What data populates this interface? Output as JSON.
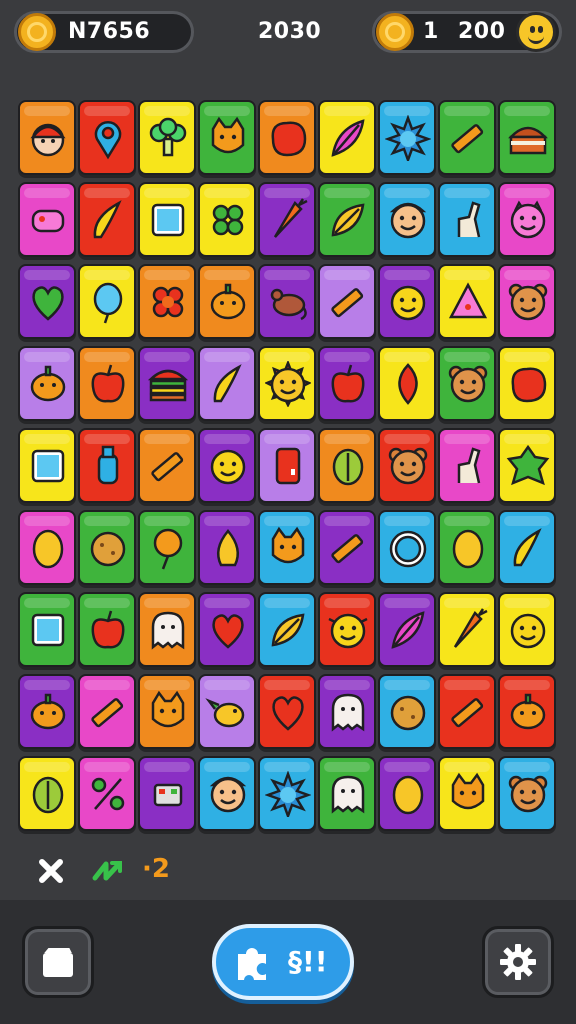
{
  "hud": {
    "player_name": "N7656",
    "score": "2030",
    "level": "1",
    "coins": "200",
    "coin_icon": "coin-icon",
    "avatar_icon": "smiley-icon"
  },
  "board": {
    "rows": 9,
    "cols": 9,
    "tiles": [
      {
        "color": "#f08a1e",
        "icon": "boy-face"
      },
      {
        "color": "#e8321e",
        "icon": "map-pin"
      },
      {
        "color": "#f7e51b",
        "icon": "broccoli"
      },
      {
        "color": "#3fb43c",
        "icon": "cat-face"
      },
      {
        "color": "#f08a1e",
        "icon": "blob"
      },
      {
        "color": "#f7e51b",
        "icon": "feather"
      },
      {
        "color": "#2fb0e4",
        "icon": "sun-gear"
      },
      {
        "color": "#3fb43c",
        "icon": "crayon"
      },
      {
        "color": "#3fb43c",
        "icon": "cake"
      },
      {
        "color": "#e848c8",
        "icon": "candy"
      },
      {
        "color": "#e8321e",
        "icon": "banana"
      },
      {
        "color": "#f7e51b",
        "icon": "tablet"
      },
      {
        "color": "#f7e51b",
        "icon": "clover"
      },
      {
        "color": "#8a2fc4",
        "icon": "carrot"
      },
      {
        "color": "#3fb43c",
        "icon": "leaf-pen"
      },
      {
        "color": "#2fb0e4",
        "icon": "man-face"
      },
      {
        "color": "#2fb0e4",
        "icon": "llama"
      },
      {
        "color": "#e848c8",
        "icon": "monster"
      },
      {
        "color": "#8a2fc4",
        "icon": "heart-leaf"
      },
      {
        "color": "#f7e51b",
        "icon": "balloon"
      },
      {
        "color": "#f08a1e",
        "icon": "flower-blob"
      },
      {
        "color": "#f08a1e",
        "icon": "pumpkin"
      },
      {
        "color": "#8a2fc4",
        "icon": "mouse"
      },
      {
        "color": "#b87ee8",
        "icon": "crayon"
      },
      {
        "color": "#8a2fc4",
        "icon": "smile-face"
      },
      {
        "color": "#f7e51b",
        "icon": "triangle"
      },
      {
        "color": "#e848c8",
        "icon": "bear-face"
      },
      {
        "color": "#b87ee8",
        "icon": "pumpkin"
      },
      {
        "color": "#f08a1e",
        "icon": "apple"
      },
      {
        "color": "#8a2fc4",
        "icon": "burger"
      },
      {
        "color": "#b87ee8",
        "icon": "banana"
      },
      {
        "color": "#f7e51b",
        "icon": "sun-face"
      },
      {
        "color": "#8a2fc4",
        "icon": "apple"
      },
      {
        "color": "#f7e51b",
        "icon": "leaf"
      },
      {
        "color": "#3fb43c",
        "icon": "bear-face"
      },
      {
        "color": "#f7e51b",
        "icon": "blob"
      },
      {
        "color": "#f7e51b",
        "icon": "tablet"
      },
      {
        "color": "#e8321e",
        "icon": "bottle"
      },
      {
        "color": "#f08a1e",
        "icon": "crayon"
      },
      {
        "color": "#8a2fc4",
        "icon": "smile-face"
      },
      {
        "color": "#b87ee8",
        "icon": "phone"
      },
      {
        "color": "#f08a1e",
        "icon": "lime"
      },
      {
        "color": "#e8321e",
        "icon": "bear-face"
      },
      {
        "color": "#e848c8",
        "icon": "llama"
      },
      {
        "color": "#f7e51b",
        "icon": "leaf-star"
      },
      {
        "color": "#e848c8",
        "icon": "lemon"
      },
      {
        "color": "#3fb43c",
        "icon": "cookie"
      },
      {
        "color": "#3fb43c",
        "icon": "lollipop"
      },
      {
        "color": "#8a2fc4",
        "icon": "corn"
      },
      {
        "color": "#2fb0e4",
        "icon": "cat-face"
      },
      {
        "color": "#8a2fc4",
        "icon": "crayon"
      },
      {
        "color": "#2fb0e4",
        "icon": "plate"
      },
      {
        "color": "#3fb43c",
        "icon": "lemon"
      },
      {
        "color": "#2fb0e4",
        "icon": "banana"
      },
      {
        "color": "#3fb43c",
        "icon": "tablet"
      },
      {
        "color": "#3fb43c",
        "icon": "apple"
      },
      {
        "color": "#f08a1e",
        "icon": "ghost"
      },
      {
        "color": "#8a2fc4",
        "icon": "heart"
      },
      {
        "color": "#2fb0e4",
        "icon": "leaf-pen"
      },
      {
        "color": "#e8321e",
        "icon": "cow-face"
      },
      {
        "color": "#8a2fc4",
        "icon": "feather"
      },
      {
        "color": "#f7e51b",
        "icon": "carrot"
      },
      {
        "color": "#f7e51b",
        "icon": "smile-face"
      },
      {
        "color": "#8a2fc4",
        "icon": "pumpkin"
      },
      {
        "color": "#e848c8",
        "icon": "crayon"
      },
      {
        "color": "#f08a1e",
        "icon": "cat-face"
      },
      {
        "color": "#b87ee8",
        "icon": "bird"
      },
      {
        "color": "#e8321e",
        "icon": "heart"
      },
      {
        "color": "#8a2fc4",
        "icon": "ghost"
      },
      {
        "color": "#2fb0e4",
        "icon": "cookie"
      },
      {
        "color": "#e8321e",
        "icon": "crayon"
      },
      {
        "color": "#e8321e",
        "icon": "pumpkin"
      },
      {
        "color": "#f7e51b",
        "icon": "lime"
      },
      {
        "color": "#e848c8",
        "icon": "percent"
      },
      {
        "color": "#8a2fc4",
        "icon": "robot"
      },
      {
        "color": "#2fb0e4",
        "icon": "man-face"
      },
      {
        "color": "#2fb0e4",
        "icon": "sun-gear"
      },
      {
        "color": "#3fb43c",
        "icon": "ghost"
      },
      {
        "color": "#8a2fc4",
        "icon": "lemon"
      },
      {
        "color": "#f7e51b",
        "icon": "cat-face"
      },
      {
        "color": "#2fb0e4",
        "icon": "bear-face"
      }
    ]
  },
  "actions": {
    "remove_icon": "close-icon",
    "shuffle_icon": "shuffle-icon",
    "count_text": "·2"
  },
  "bottom_bar": {
    "menu_icon": "clapperboard-icon",
    "hint_label": "§!!",
    "hint_icon": "puzzle-icon",
    "settings_icon": "gear-icon"
  },
  "colors": {
    "background": "#3a3b3e",
    "hint_button": "#2e9ce8",
    "coin": "#f3b21f"
  }
}
